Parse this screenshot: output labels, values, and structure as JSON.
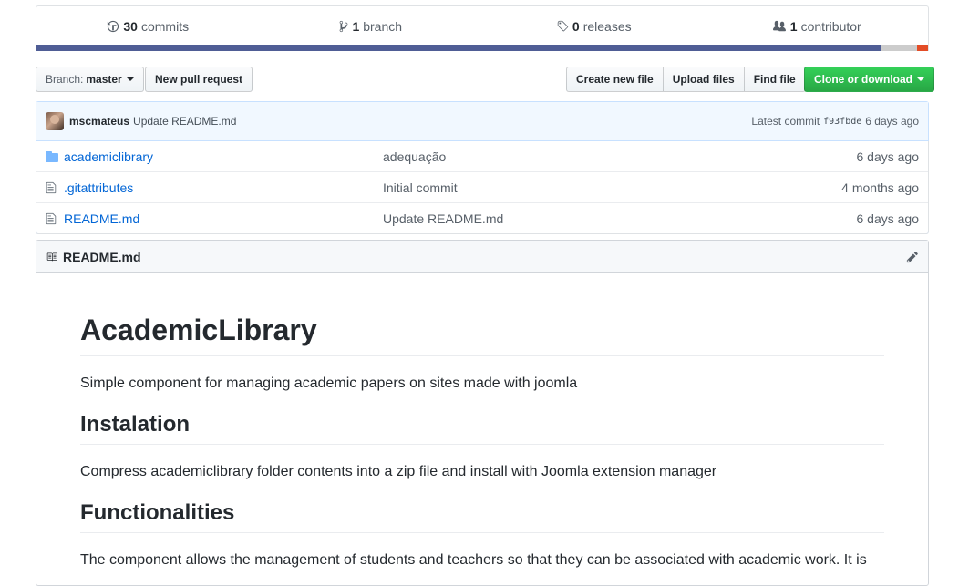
{
  "summary": {
    "commits": {
      "count": "30",
      "label": "commits"
    },
    "branches": {
      "count": "1",
      "label": "branch"
    },
    "releases": {
      "count": "0",
      "label": "releases"
    },
    "contributors": {
      "count": "1",
      "label": "contributor"
    },
    "language_colors": [
      "#4f5d95",
      "#cccccc",
      "#e34c26"
    ],
    "language_shares": [
      0.948,
      0.04,
      0.012
    ]
  },
  "toolbar": {
    "branch_prefix": "Branch:",
    "branch_name": "master",
    "new_pull_request": "New pull request",
    "create_new_file": "Create new file",
    "upload_files": "Upload files",
    "find_file": "Find file",
    "clone_or_download": "Clone or download"
  },
  "latest_commit": {
    "author": "mscmateus",
    "message": "Update README.md",
    "label": "Latest commit",
    "sha": "f93fbde",
    "age": "6 days ago"
  },
  "files": [
    {
      "type": "folder-icon",
      "name": "academiclibrary",
      "message": "adequação",
      "age": "6 days ago"
    },
    {
      "type": "file-icon",
      "name": ".gitattributes",
      "message": "Initial commit",
      "age": "4 months ago"
    },
    {
      "type": "file-icon",
      "name": "README.md",
      "message": "Update README.md",
      "age": "6 days ago"
    }
  ],
  "readme": {
    "filename": "README.md",
    "title": "AcademicLibrary",
    "intro": "Simple component for managing academic papers on sites made with joomla",
    "sections": [
      {
        "heading": "Instalation",
        "text": "Compress academiclibrary folder contents into a zip file and install with Joomla extension manager"
      },
      {
        "heading": "Functionalities",
        "text": "The component allows the management of students and teachers so that they can be associated with academic work. It is"
      }
    ]
  }
}
